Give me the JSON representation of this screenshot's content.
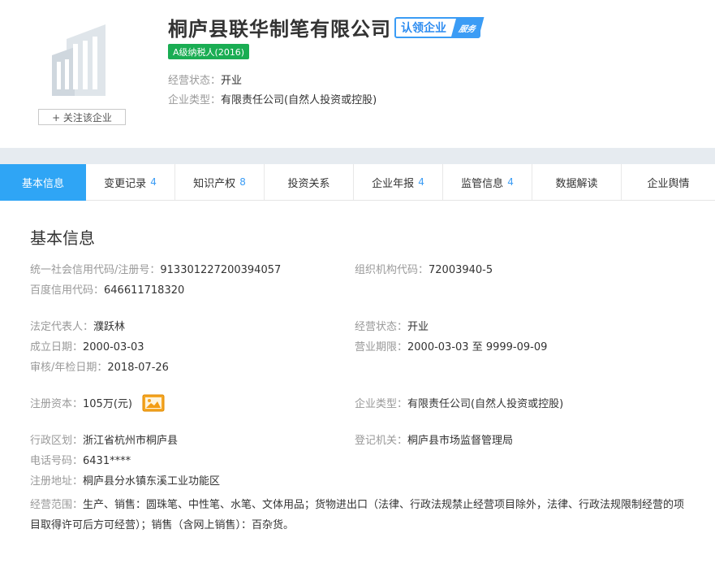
{
  "header": {
    "company_name": "桐庐县联华制笔有限公司",
    "claim_text": "认领企业",
    "claim_tag": "服务",
    "tax_badge": "A级纳税人(2016)",
    "status_key": "经营状态：",
    "status_val": "开业",
    "type_key": "企业类型：",
    "type_val": "有限责任公司(自然人投资或控股)",
    "follow_label": "+ 关注该企业"
  },
  "tabs": [
    {
      "label": "基本信息",
      "count": ""
    },
    {
      "label": "变更记录",
      "count": "4"
    },
    {
      "label": "知识产权",
      "count": "8"
    },
    {
      "label": "投资关系",
      "count": ""
    },
    {
      "label": "企业年报",
      "count": "4"
    },
    {
      "label": "监管信息",
      "count": "4"
    },
    {
      "label": "数据解读",
      "count": ""
    },
    {
      "label": "企业舆情",
      "count": ""
    }
  ],
  "info": {
    "title": "基本信息",
    "credit_code_k": "统一社会信用代码/注册号：",
    "credit_code_v": "913301227200394057",
    "org_code_k": "组织机构代码：",
    "org_code_v": "72003940-5",
    "baidu_code_k": "百度信用代码：",
    "baidu_code_v": "646611718320",
    "legal_rep_k": "法定代表人：",
    "legal_rep_v": "濮跃林",
    "status_k": "经营状态：",
    "status_v": "开业",
    "found_date_k": "成立日期：",
    "found_date_v": "2000-03-03",
    "term_k": "营业期限：",
    "term_v": "2000-03-03 至 9999-09-09",
    "audit_date_k": "审核/年检日期：",
    "audit_date_v": "2018-07-26",
    "capital_k": "注册资本：",
    "capital_v": "105万(元)",
    "company_type_k": "企业类型：",
    "company_type_v": "有限责任公司(自然人投资或控股)",
    "region_k": "行政区划：",
    "region_v": "浙江省杭州市桐庐县",
    "authority_k": "登记机关：",
    "authority_v": "桐庐县市场监督管理局",
    "phone_k": "电话号码：",
    "phone_v": "6431****",
    "address_k": "注册地址：",
    "address_v": "桐庐县分水镇东溪工业功能区",
    "scope_k": "经营范围：",
    "scope_v": "生产、销售：圆珠笔、中性笔、水笔、文体用品；货物进出口（法律、行政法规禁止经营项目除外，法律、行政法规限制经营的项目取得许可后方可经营）；销售（含网上销售）：百杂货。"
  }
}
